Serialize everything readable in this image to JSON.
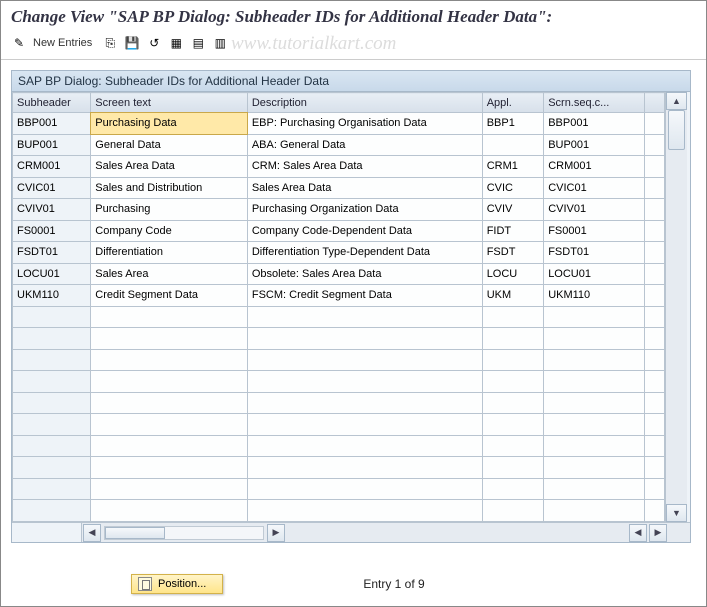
{
  "title": "Change View \"SAP BP Dialog: Subheader IDs for Additional Header Data\":",
  "toolbar": {
    "new_entries": "New Entries"
  },
  "watermark": "www.tutorialkart.com",
  "panel": {
    "title": "SAP BP Dialog: Subheader IDs for Additional Header Data"
  },
  "columns": [
    "Subheader",
    "Screen text",
    "Description",
    "Appl.",
    "Scrn.seq.c...",
    ""
  ],
  "rows": [
    {
      "c0": "BBP001",
      "c1": "Purchasing Data",
      "c2": "EBP: Purchasing Organisation Data",
      "c3": "BBP1",
      "c4": "BBP001"
    },
    {
      "c0": "BUP001",
      "c1": "General Data",
      "c2": "ABA: General Data",
      "c3": "",
      "c4": "BUP001"
    },
    {
      "c0": "CRM001",
      "c1": "Sales Area Data",
      "c2": "CRM: Sales Area Data",
      "c3": "CRM1",
      "c4": "CRM001"
    },
    {
      "c0": "CVIC01",
      "c1": "Sales and Distribution",
      "c2": "Sales Area Data",
      "c3": "CVIC",
      "c4": "CVIC01"
    },
    {
      "c0": "CVIV01",
      "c1": "Purchasing",
      "c2": "Purchasing Organization Data",
      "c3": "CVIV",
      "c4": "CVIV01"
    },
    {
      "c0": "FS0001",
      "c1": "Company Code",
      "c2": "Company Code-Dependent Data",
      "c3": "FIDT",
      "c4": "FS0001"
    },
    {
      "c0": "FSDT01",
      "c1": "Differentiation",
      "c2": "Differentiation Type-Dependent Data",
      "c3": "FSDT",
      "c4": "FSDT01"
    },
    {
      "c0": "LOCU01",
      "c1": "Sales Area",
      "c2": "Obsolete: Sales Area Data",
      "c3": "LOCU",
      "c4": "LOCU01"
    },
    {
      "c0": "UKM110",
      "c1": "Credit Segment Data",
      "c2": "FSCM: Credit Segment Data",
      "c3": "UKM",
      "c4": "UKM110"
    }
  ],
  "selected_cell": {
    "row": 0,
    "col": "c1"
  },
  "footer": {
    "position_btn": "Position...",
    "entry_text": "Entry 1 of 9"
  },
  "icons": {
    "wand": "✎",
    "copy": "⎘",
    "save": "💾",
    "undo": "↺",
    "t1": "▦",
    "t2": "▤",
    "t3": "▥"
  }
}
